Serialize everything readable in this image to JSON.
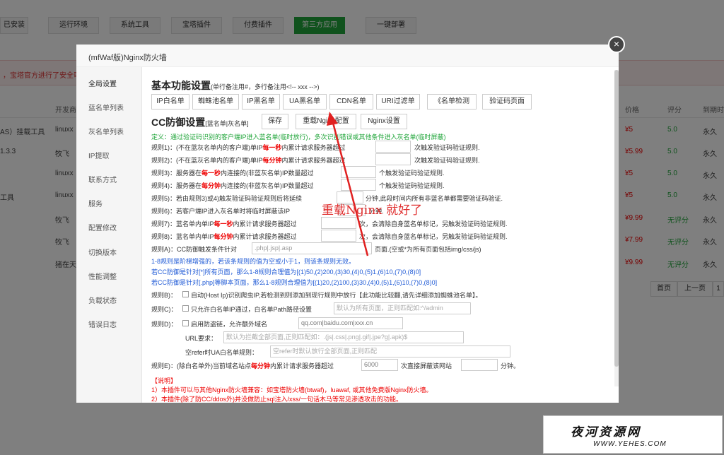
{
  "top_tabs": [
    "已安装",
    "运行环境",
    "系统工具",
    "宝塔插件",
    "付费插件",
    "第三方应用",
    "一键部署"
  ],
  "notice": "，宝塔官方进行了安全审",
  "table": {
    "headers": {
      "dev": "开发商",
      "price": "价格",
      "score": "评分",
      "expire": "到期时"
    },
    "rows": [
      {
        "name": "AS）挂载工具",
        "dev": "linuxx",
        "price": "¥5",
        "score": "5.0",
        "expire": "永久"
      },
      {
        "name": "1.3.3",
        "dev": "牧飞",
        "price": "¥5.99",
        "score": "5.0",
        "expire": "永久"
      },
      {
        "name": "",
        "dev": "linuxx",
        "price": "¥5",
        "score": "5.0",
        "expire": "永久"
      },
      {
        "name": "工具",
        "dev": "linuxx",
        "price": "¥5",
        "score": "5.0",
        "expire": "永久"
      },
      {
        "name": "",
        "dev": "牧飞",
        "price": "¥9.99",
        "score": "无评分",
        "expire": "永久"
      },
      {
        "name": "",
        "dev": "牧飞",
        "price": "¥7.99",
        "score": "无评分",
        "expire": "永久"
      },
      {
        "name": "",
        "dev": "猪在天",
        "price": "¥9.99",
        "score": "无评分",
        "expire": "永久"
      }
    ]
  },
  "pager": {
    "first": "首页",
    "prev": "上一页",
    "next": "1"
  },
  "dialog": {
    "title": "(mfWaf版)Nginx防火墙",
    "close": "×",
    "sidebar": [
      "全局设置",
      "蓝名单列表",
      "灰名单列表",
      "IP提取",
      "联系方式",
      "服务",
      "配置修改",
      "切换版本",
      "性能调整",
      "负载状态",
      "错误日志"
    ],
    "basic_title": "基本功能设置",
    "basic_sub": "(单行备注用#，多行备注用<!-- xxx -->)",
    "basic_buttons": [
      "IP白名单",
      "蜘蛛池名单",
      "IP黑名单",
      "UA黑名单",
      "CDN名单",
      "URI过滤单",
      "《名单检测",
      "验证码页面"
    ],
    "cc_title": "CC防御设置",
    "cc_sub": "[蓝名单|灰名单]",
    "cc_buttons": [
      "保存",
      "重载Nginx配置",
      "Nginx设置"
    ],
    "definition": "定义：通过验证码识别的客户端IP进入蓝名单(临时放行)，多次识别错误或其他条件进入灰名单(临时屏蔽)",
    "rules": [
      {
        "a": "规则1)：(不在蓝灰名单内的客户端)单IP",
        "b": "每一秒",
        "c": "内累计请求服务器超过",
        "d": "次触发验证码验证规则."
      },
      {
        "a": "规则2)：(不在蓝灰名单内的客户端)单IP",
        "b": "每分钟",
        "c": "内累计请求服务器超过",
        "d": "次触发验证码验证规则."
      },
      {
        "a": "规则3)：服务器在",
        "b": "每一秒",
        "c": "内连接的(非蓝灰名单)IP数量超过",
        "d": "个触发验证码验证规则."
      },
      {
        "a": "规则4)：服务器在",
        "b": "每分钟",
        "c": "内连接的(非蓝灰名单)IP数量超过",
        "d": "个触发验证码验证规则."
      },
      {
        "a": "规则5)：若由规则3)或4)触发验证码验证规则后将延续",
        "b": "",
        "c": "",
        "d": "分钟,此段时间内所有非蓝名单都需要验证码验证."
      },
      {
        "a": "规则6)：若客户端IP进入灰名单时将临时屏蔽该IP",
        "b": "",
        "c": "",
        "d": "分钟."
      },
      {
        "a": "规则7)：蓝名单内单IP",
        "b": "每一秒",
        "c": "内累计请求服务器超过",
        "d": "次，会清除自身蓝名单标记，另触发验证码验证规则."
      },
      {
        "a": "规则8)：蓝名单内单IP",
        "b": "每分钟",
        "c": "内累计请求服务器超过",
        "d": "次，会清除自身蓝名单标记，另触发验证码验证规则."
      }
    ],
    "ruleA": {
      "label": "规则A)：CC防御触发条件针对",
      "value": ".php|.jsp|.asp",
      "suffix": "页面.(空或*为所有页面包括img/css/js)"
    },
    "note_green": "1-8规则是阶梯增强的，若该条规则的值为空或小于1，则该条规则无效。",
    "note_blue1": "若CC防御是针对[*]所有页面，那么1-8规则合理值为[(1)50,(2)200,(3)30,(4)0,(5)1,(6)10,(7)0,(8)0]",
    "note_blue2": "若CC防御是针对[.php]等脚本页面，那么1-8规则合理值为[(1)20,(2)100,(3)30,(4)0,(5)1,(6)10,(7)0,(8)0]",
    "ruleB": {
      "a": "规则B)：",
      "text": "自动(Host Ip)识别爬虫IP,若检测到则添加到现行规则中放行【此功能比较翻,请先详细添加蜘蛛池名单】。"
    },
    "ruleC": {
      "a": "规则C)：",
      "text": "只允许白名单IP通过，白名单Path路径设置",
      "placeholder": "默认为所有页面，正则匹配如:^/admin"
    },
    "ruleD": {
      "a": "规则D)：",
      "text": "启用防盗链，允许额外域名",
      "value": "qq.com|baidu.com|xxx.cn"
    },
    "url_req": {
      "label": "URL要求：",
      "placeholder": "默认为拦截全部页面,正则匹配如：.(js|.css|.png|.gif|.jpe?g|.apk)$"
    },
    "refer_ua": {
      "label": "空refer时UA白名单规则：",
      "placeholder": "空refer时默认放行全部页面,正则匹配"
    },
    "ruleE": {
      "a": "规则E)：(除白名单外)当前域名站点",
      "b": "每分钟",
      "c": "内累计请求服务器超过",
      "value": "6000",
      "mid": "次直接屏蔽该网站",
      "d": "分钟。"
    },
    "explain_title": "【说明】",
    "explain1": "1）本插件可以与其他Nginx防火墙兼容：如宝塔防火墙(btwaf)，luawaf, 或其他免费版Nginx防火墙。",
    "explain2": "2）本插件(除了防CC/ddos外)并没做防止sql注入/xss/一句话木马等常见渗透攻击的功能。"
  },
  "annotation": "重载Nginx 就好了",
  "watermark": {
    "title": "夜河资源网",
    "url": "WWW.YEHES.COM"
  },
  "colors": {
    "accent": "#20a53a",
    "danger": "#e00000",
    "link": "#1f5ad6"
  }
}
